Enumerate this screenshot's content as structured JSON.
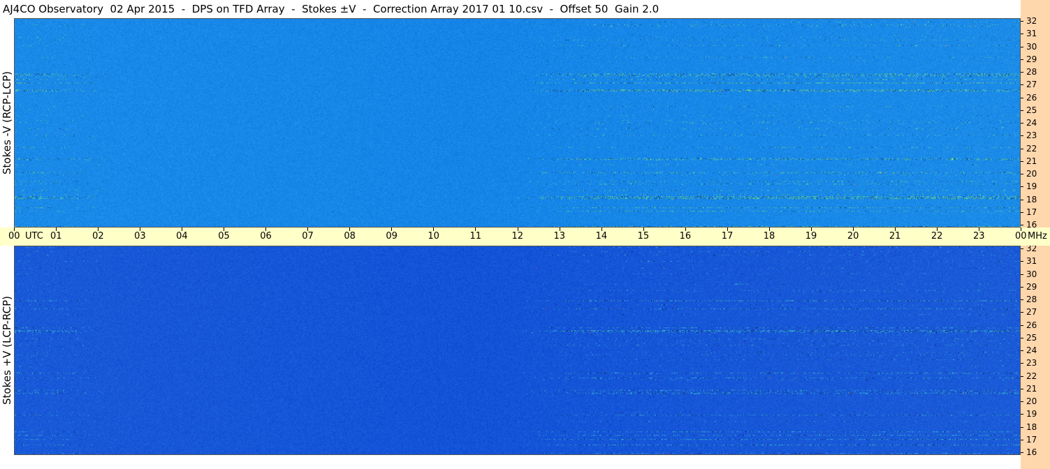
{
  "title": "AJ4CO Observatory  02 Apr 2015  -  DPS on TFD Array  -  Stokes ±V  -  Correction Array 2017 01 10.csv  -  Offset 50  Gain 2.0",
  "chart_data": [
    {
      "type": "heatmap",
      "ylabel": "Stokes -V (RCP-LCP)",
      "y_ticks": [
        32,
        31,
        30,
        29,
        28,
        27,
        26,
        25,
        24,
        23,
        22,
        21,
        20,
        19,
        18,
        17,
        16
      ],
      "y_unit": "MHz",
      "ylim": [
        16,
        32
      ],
      "x_ticks": [
        "00",
        "01",
        "02",
        "03",
        "04",
        "05",
        "06",
        "07",
        "08",
        "09",
        "10",
        "11",
        "12",
        "13",
        "14",
        "15",
        "16",
        "17",
        "18",
        "19",
        "20",
        "21",
        "22",
        "23",
        "00"
      ],
      "x_unit": "UTC",
      "xlim": [
        0,
        24
      ],
      "colors": {
        "base": "#1f8fe8",
        "activity": "#80f070",
        "dark": "#0a1a50"
      }
    },
    {
      "type": "heatmap",
      "ylabel": "Stokes +V (LCP-RCP)",
      "y_ticks": [
        32,
        31,
        30,
        29,
        28,
        27,
        26,
        25,
        24,
        23,
        22,
        21,
        20,
        19,
        18,
        17,
        16
      ],
      "y_unit": "MHz",
      "ylim": [
        16,
        32
      ],
      "x_ticks": [
        "00",
        "01",
        "02",
        "03",
        "04",
        "05",
        "06",
        "07",
        "08",
        "09",
        "10",
        "11",
        "12",
        "13",
        "14",
        "15",
        "16",
        "17",
        "18",
        "19",
        "20",
        "21",
        "22",
        "23",
        "00"
      ],
      "x_unit": "UTC",
      "xlim": [
        0,
        24
      ],
      "colors": {
        "base": "#1f5fd8",
        "activity": "#40d0d0",
        "dark": "#081640"
      }
    }
  ],
  "time_axis": {
    "utc_label": "UTC",
    "mhz_label": "MHz"
  }
}
